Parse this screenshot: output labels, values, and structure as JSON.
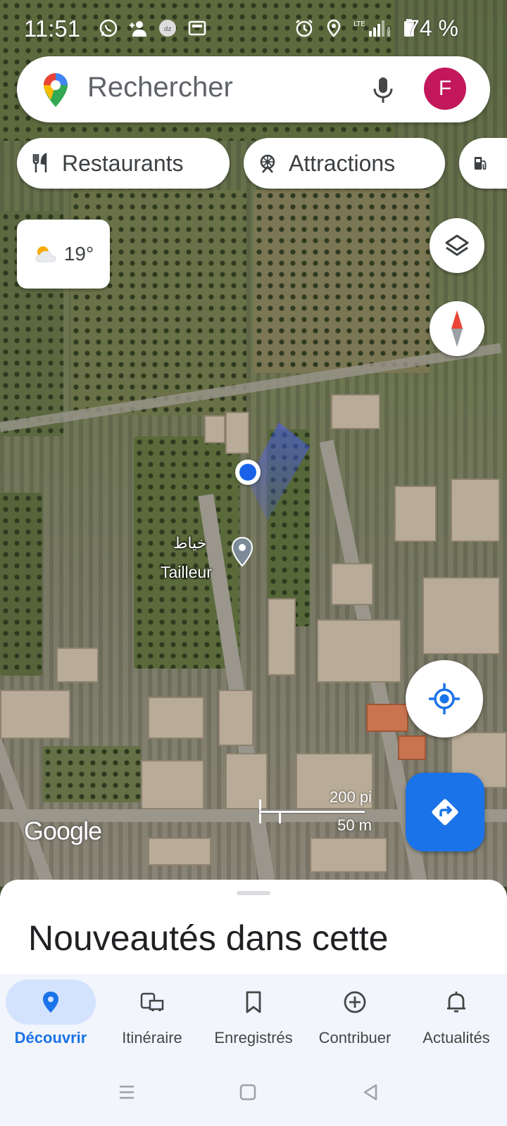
{
  "status_bar": {
    "time": "11:51",
    "battery": "74 %",
    "network": "LTE",
    "left_icons": [
      "whatsapp-icon",
      "person-add-icon",
      "chat-icon",
      "news-icon"
    ],
    "right_icons": [
      "alarm-icon",
      "location-icon",
      "signal-icon",
      "battery-icon"
    ]
  },
  "search": {
    "placeholder": "Rechercher",
    "avatar_letter": "F"
  },
  "chips": [
    {
      "label": "Restaurants",
      "icon": "restaurant-icon"
    },
    {
      "label": "Attractions",
      "icon": "attraction-icon"
    },
    {
      "label": "",
      "icon": "gas-station-icon"
    }
  ],
  "weather": {
    "temperature": "19°",
    "icon": "partly-cloudy-icon"
  },
  "map": {
    "poi": {
      "name_ar": "خياط",
      "name": "Tailleur"
    },
    "attribution": "Google",
    "scale": {
      "imperial": "200 pi",
      "metric": "50 m"
    }
  },
  "sheet": {
    "title": "Nouveautés dans cette"
  },
  "bottom_nav": [
    {
      "label": "Découvrir",
      "icon": "explore-pin-icon",
      "active": true
    },
    {
      "label": "Itinéraire",
      "icon": "commute-icon",
      "active": false
    },
    {
      "label": "Enregistrés",
      "icon": "bookmark-icon",
      "active": false
    },
    {
      "label": "Contribuer",
      "icon": "add-circle-icon",
      "active": false
    },
    {
      "label": "Actualités",
      "icon": "bell-icon",
      "active": false
    }
  ],
  "colors": {
    "accent": "#1a73e8",
    "avatar": "#c2185b",
    "nav_active_pill": "#d3e3fd"
  }
}
